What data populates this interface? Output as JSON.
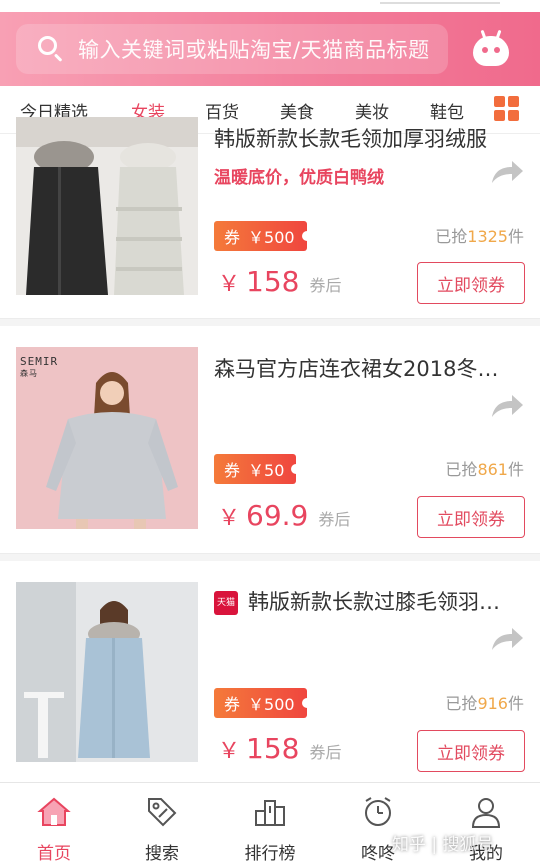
{
  "search": {
    "placeholder": "输入关键词或粘贴淘宝/天猫商品标题"
  },
  "header": {
    "robot_icon": "robot-icon"
  },
  "tabs": [
    {
      "label": "今日精选",
      "active": false
    },
    {
      "label": "女装",
      "active": true
    },
    {
      "label": "百货",
      "active": false
    },
    {
      "label": "美食",
      "active": false
    },
    {
      "label": "美妆",
      "active": false
    },
    {
      "label": "鞋包",
      "active": false
    }
  ],
  "products": [
    {
      "title": "韩版新款长款毛领加厚羽绒服",
      "subtitle": "温暖底价，优质白鸭绒",
      "coupon_prefix": "券",
      "coupon_value": "￥500",
      "sold_prefix": "已抢",
      "sold_count": "1325",
      "sold_suffix": "件",
      "price_symbol": "￥",
      "price": "158",
      "price_suffix": "券后",
      "button": "立即领券"
    },
    {
      "title": "森马官方店连衣裙女2018冬…",
      "coupon_prefix": "券",
      "coupon_value": "￥50",
      "sold_prefix": "已抢",
      "sold_count": "861",
      "sold_suffix": "件",
      "price_symbol": "￥",
      "price": "69.9",
      "price_suffix": "券后",
      "button": "立即领券",
      "brand_logo": "SEMIR",
      "brand_logo_cn": "森马"
    },
    {
      "badge": "天猫",
      "title": "韩版新款长款过膝毛领羽…",
      "coupon_prefix": "券",
      "coupon_value": "￥500",
      "sold_prefix": "已抢",
      "sold_count": "916",
      "sold_suffix": "件",
      "price_symbol": "￥",
      "price": "158",
      "price_suffix": "券后",
      "button": "立即领券"
    }
  ],
  "bottom_nav": [
    {
      "label": "首页",
      "icon": "home-icon",
      "active": true
    },
    {
      "label": "搜索",
      "icon": "tag-icon",
      "active": false
    },
    {
      "label": "排行榜",
      "icon": "podium-icon",
      "active": false
    },
    {
      "label": "咚咚",
      "icon": "alarm-clock-icon",
      "active": false
    },
    {
      "label": "我的",
      "icon": "user-icon",
      "active": false
    }
  ],
  "watermark": "知乎 | 搜狐号",
  "colors": {
    "accent": "#e8455f",
    "header_start": "#f8a0b4",
    "header_end": "#f06a8c",
    "coupon": "#f0463f",
    "sold_count": "#f0a84a"
  }
}
